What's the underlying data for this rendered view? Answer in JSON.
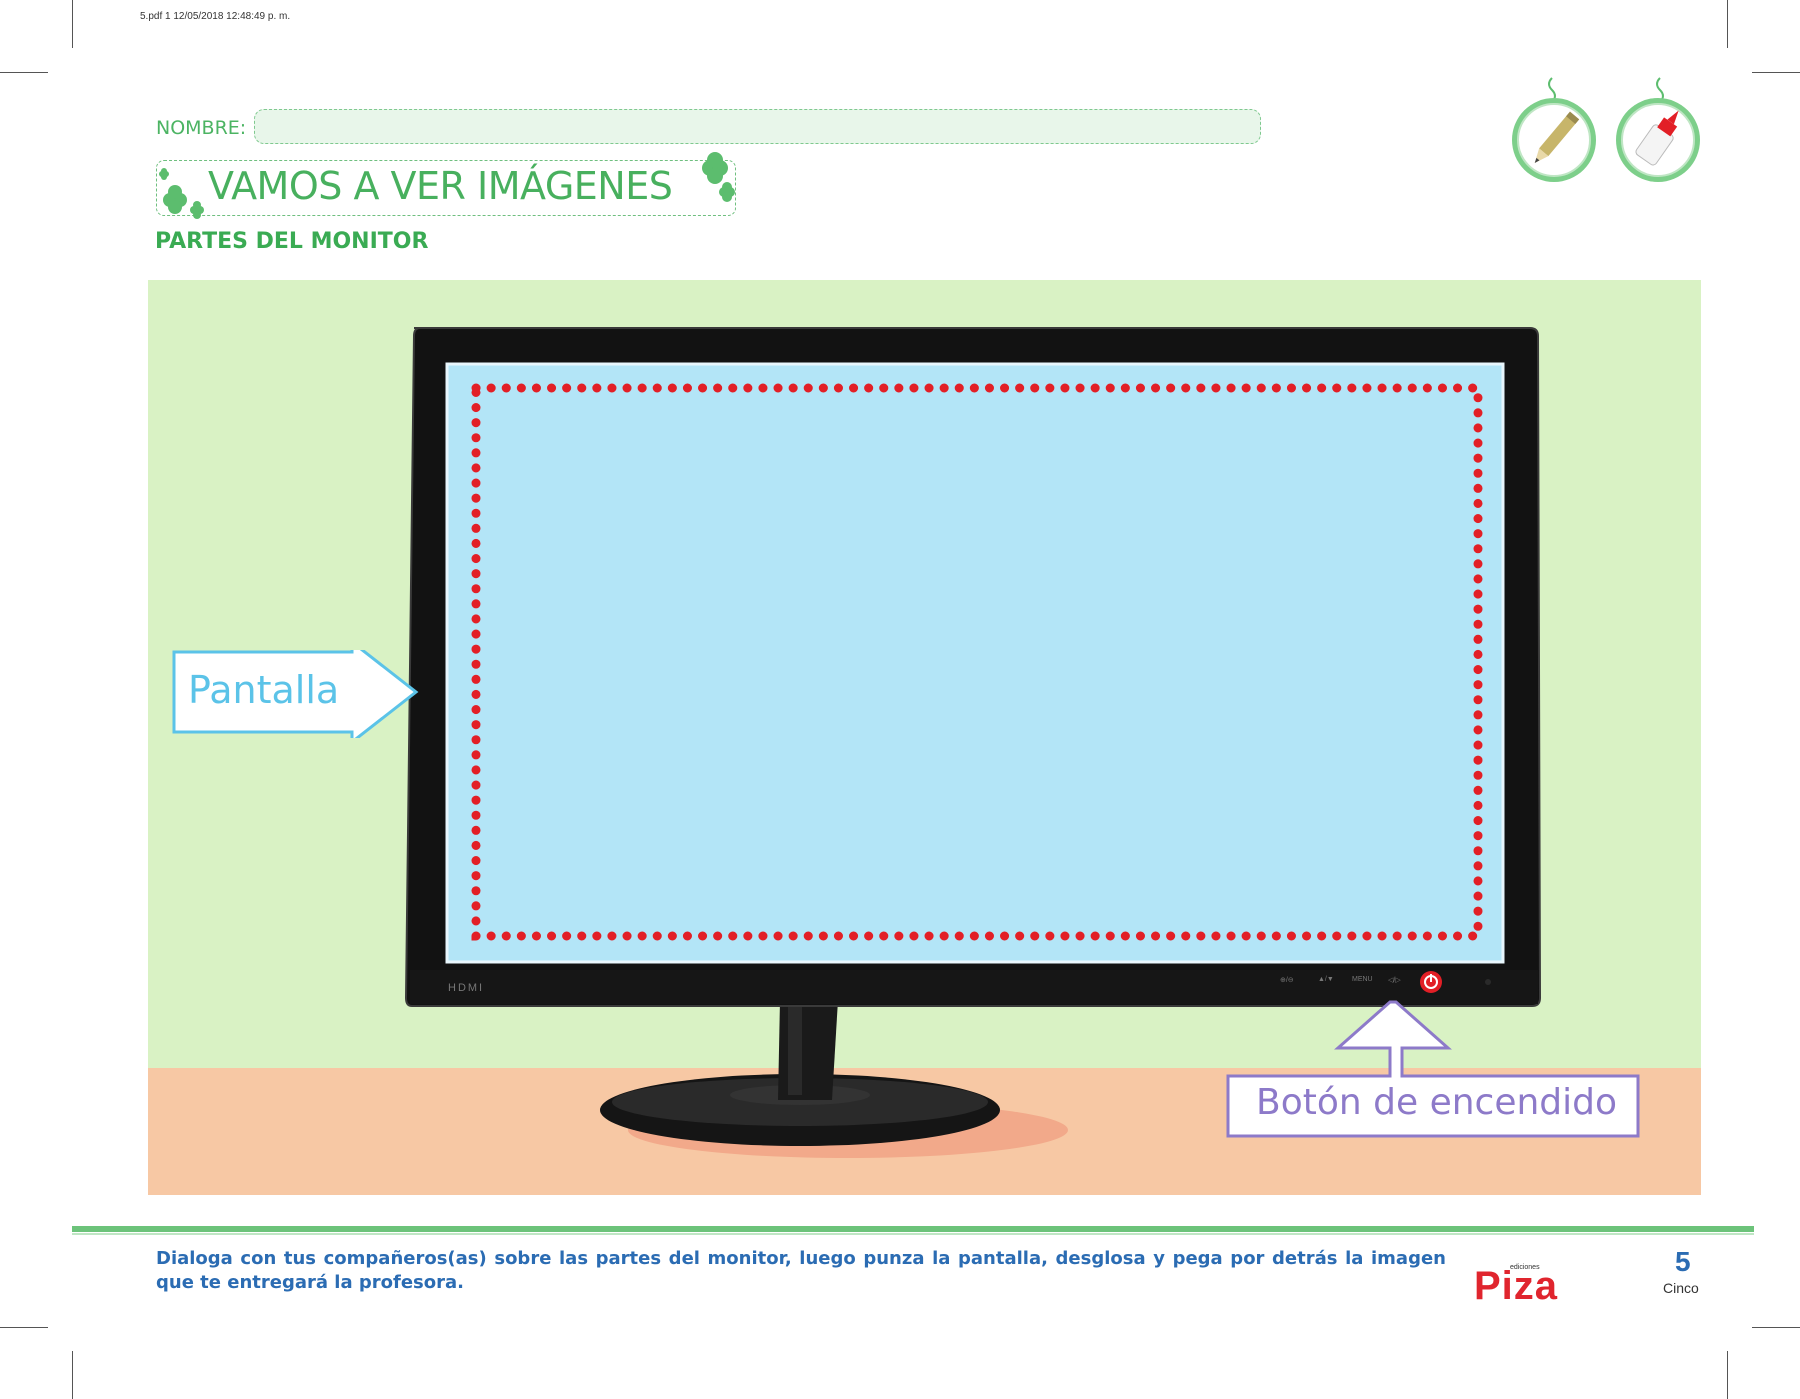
{
  "print_info": "5.pdf   1   12/05/2018   12:48:49 p. m.",
  "header": {
    "name_label": "NOMBRE:",
    "title": "VAMOS A VER IMÁGENES",
    "subtitle": "PARTES DEL MONITOR"
  },
  "tool_icons": [
    "pencil-icon",
    "glue-icon"
  ],
  "monitor": {
    "brand_mark": "HDMI",
    "buttons": [
      "⊕/⊖",
      "▲/▼",
      "MENU",
      "◁/▷"
    ],
    "labels": {
      "screen": "Pantalla",
      "power_button": "Botón de encendido"
    }
  },
  "footer": {
    "instruction": "Dialoga con tus compañeros(as) sobre las partes del monitor, luego punza la pantalla, desglosa y pega por detrás la imagen que te entregará la profesora.",
    "publisher_small": "ediciones",
    "publisher": "Piza",
    "page_number": "5",
    "page_word": "Cinco"
  },
  "colors": {
    "title_green": "#48b05e",
    "screen_blue": "#b3e5f7",
    "dot_red": "#e21f26",
    "wall_green": "#d9f2c4",
    "desk_peach": "#f7c8a4",
    "pantalla_blue": "#5bc3e8",
    "boton_purple": "#8d7ac9",
    "footer_blue": "#2b6cb3"
  }
}
